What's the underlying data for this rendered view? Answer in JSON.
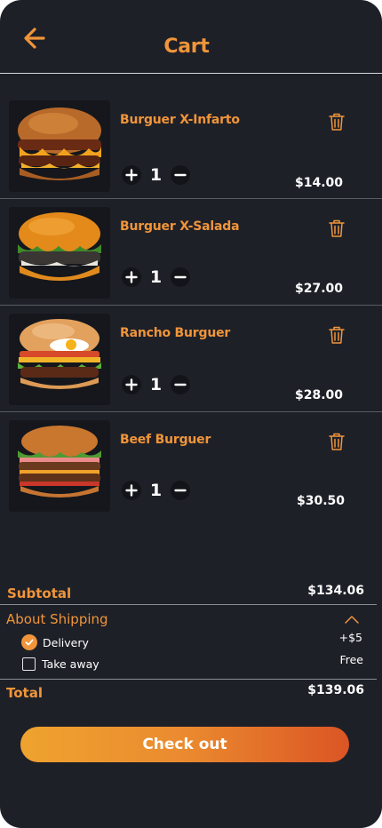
{
  "header": {
    "title": "Cart",
    "back_icon": "arrow-left-icon"
  },
  "items": [
    {
      "name": "Burguer X-Infarto",
      "quantity": "1",
      "price": "$14.00"
    },
    {
      "name": "Burguer X-Salada",
      "quantity": "1",
      "price": "$27.00"
    },
    {
      "name": "Rancho Burguer",
      "quantity": "1",
      "price": "$28.00"
    },
    {
      "name": "Beef Burguer",
      "quantity": "1",
      "price": "$30.50"
    }
  ],
  "summary": {
    "subtotal_label": "Subtotal",
    "subtotal_value": "$134.06",
    "shipping_label": "About Shipping",
    "options": [
      {
        "label": "Delivery",
        "price": "+$5",
        "checked": true
      },
      {
        "label": "Take away",
        "price": "Free",
        "checked": false
      }
    ],
    "total_label": "Total",
    "total_value": "$139.06"
  },
  "checkout_label": "Check out",
  "colors": {
    "accent": "#f0953a",
    "background": "#1e2028",
    "gradient_start": "#efa32f",
    "gradient_end": "#db5524"
  }
}
